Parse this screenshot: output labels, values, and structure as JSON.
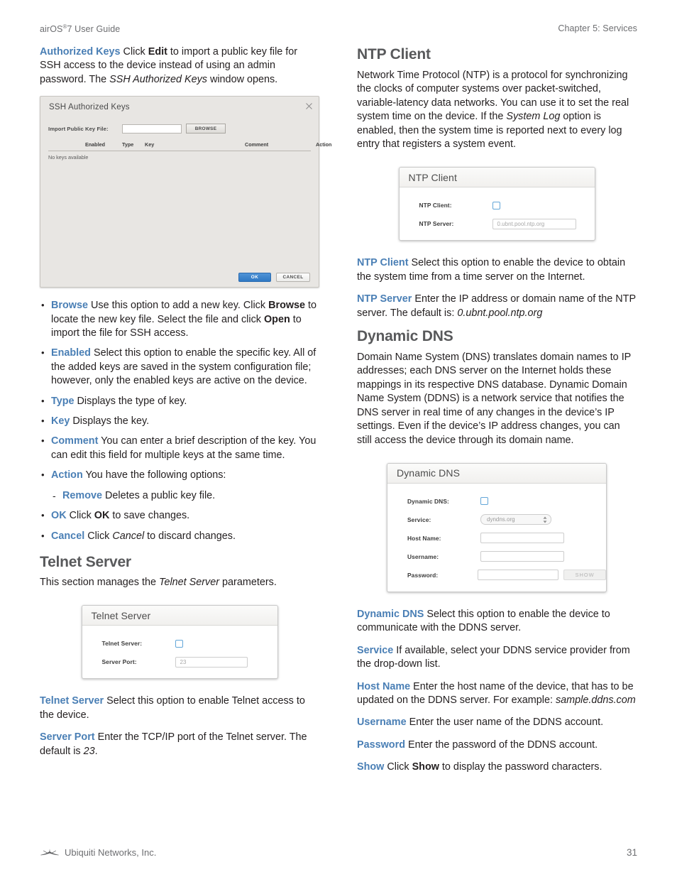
{
  "header": {
    "left_pre": "airOS",
    "left_reg": "®",
    "left_post": "7 User Guide",
    "right": "Chapter 5: Services"
  },
  "left_column": {
    "authorized_keys": {
      "lead": "Authorized Keys",
      "text_1": "  Click ",
      "bold_1": "Edit",
      "text_2": " to import a public key file for SSH access to the device instead of using an admin password. The ",
      "italic_1": "SSH Authorized Keys",
      "text_3": " window opens."
    },
    "ssh_dialog": {
      "title": "SSH Authorized Keys",
      "close_icon": "close-icon",
      "import_label": "Import Public Key File:",
      "import_value": "",
      "browse_button": "BROWSE",
      "columns": [
        "Enabled",
        "Type",
        "Key",
        "Comment",
        "Action"
      ],
      "empty_message": "No keys available",
      "ok_button": "OK",
      "cancel_button": "CANCEL"
    },
    "bullets": [
      {
        "lead": "Browse",
        "parts": [
          {
            "t": "  Use this option to add a new key. Click "
          },
          {
            "t": "Browse",
            "s": "bold"
          },
          {
            "t": " to locate the new key file. Select the file and click "
          },
          {
            "t": "Open",
            "s": "bold"
          },
          {
            "t": " to import the file for SSH access."
          }
        ]
      },
      {
        "lead": "Enabled",
        "parts": [
          {
            "t": "  Select this option to enable the specific key. All of the added keys are saved in the system configuration file; however, only the enabled keys are active on the device."
          }
        ]
      },
      {
        "lead": "Type",
        "parts": [
          {
            "t": "  Displays the type of key."
          }
        ]
      },
      {
        "lead": "Key",
        "parts": [
          {
            "t": "  Displays the key."
          }
        ]
      },
      {
        "lead": "Comment",
        "parts": [
          {
            "t": "  You can enter a brief description of the key. You can edit this field for multiple keys at the same time."
          }
        ]
      },
      {
        "lead": "Action",
        "parts": [
          {
            "t": "  You have the following options:"
          }
        ]
      },
      {
        "sub": true,
        "lead": "Remove",
        "parts": [
          {
            "t": "  Deletes a public key file."
          }
        ]
      },
      {
        "lead": "OK",
        "parts": [
          {
            "t": "  Click "
          },
          {
            "t": "OK",
            "s": "bold"
          },
          {
            "t": " to save changes."
          }
        ]
      },
      {
        "lead": "Cancel",
        "parts": [
          {
            "t": "  Click "
          },
          {
            "t": "Cancel",
            "s": "italic"
          },
          {
            "t": " to discard changes."
          }
        ]
      }
    ],
    "telnet_heading": "Telnet Server",
    "telnet_intro": {
      "text_1": "This section manages the ",
      "italic_1": "Telnet Server",
      "text_2": " parameters."
    },
    "telnet_panel": {
      "title": "Telnet Server",
      "rows": [
        {
          "label": "Telnet Server:",
          "type": "checkbox",
          "checked": false
        },
        {
          "label": "Server Port:",
          "type": "text",
          "value": "23"
        }
      ]
    },
    "telnet_desc": [
      {
        "lead": "Telnet Server",
        "parts": [
          {
            "t": "  Select this option to enable Telnet access to the device."
          }
        ]
      },
      {
        "lead": "Server Port",
        "parts": [
          {
            "t": "  Enter the TCP/IP port of the Telnet server. The default is "
          },
          {
            "t": "23",
            "s": "italic"
          },
          {
            "t": "."
          }
        ]
      }
    ]
  },
  "right_column": {
    "ntp_heading": "NTP Client",
    "ntp_intro": {
      "text_1": "Network Time Protocol (NTP) is a protocol for synchronizing the clocks of computer systems over packet-switched, variable-latency data networks. You can use it to set the real system time on the device. If the ",
      "italic_1": "System Log",
      "text_2": " option is enabled, then the system time is reported next to every log entry that registers a system event."
    },
    "ntp_panel": {
      "title": "NTP Client",
      "rows": [
        {
          "label": "NTP Client:",
          "type": "checkbox",
          "checked": false
        },
        {
          "label": "NTP Server:",
          "type": "text",
          "value": "0.ubnt.pool.ntp.org"
        }
      ]
    },
    "ntp_desc": [
      {
        "lead": "NTP Client",
        "parts": [
          {
            "t": "  Select this option to enable the device to obtain the system time from a time server on the Internet."
          }
        ]
      },
      {
        "lead": "NTP Server",
        "parts": [
          {
            "t": "  Enter the IP address or domain name of the NTP server. The default is: "
          },
          {
            "t": "0.ubnt.pool.ntp.org",
            "s": "italic"
          }
        ]
      }
    ],
    "ddns_heading": "Dynamic DNS",
    "ddns_intro": "Domain Name System (DNS) translates domain names to IP addresses; each DNS server on the Internet holds these mappings in its respective DNS database. Dynamic Domain Name System (DDNS) is a network service that notifies the DNS server in real time of any changes in the device’s IP settings. Even if the device’s IP address changes, you can still access the device through its domain name.",
    "ddns_panel": {
      "title": "Dynamic DNS",
      "rows": [
        {
          "label": "Dynamic DNS:",
          "type": "checkbox",
          "checked": false
        },
        {
          "label": "Service:",
          "type": "select",
          "value": "dyndns.org"
        },
        {
          "label": "Host Name:",
          "type": "text",
          "value": ""
        },
        {
          "label": "Username:",
          "type": "text",
          "value": ""
        },
        {
          "label": "Password:",
          "type": "password",
          "value": "",
          "button": "SHOW"
        }
      ]
    },
    "ddns_desc": [
      {
        "lead": "Dynamic DNS",
        "parts": [
          {
            "t": "  Select this option to enable the device to communicate with the DDNS server."
          }
        ]
      },
      {
        "lead": "Service",
        "parts": [
          {
            "t": "  If available, select your DDNS service provider from the drop-down list."
          }
        ]
      },
      {
        "lead": "Host Name",
        "parts": [
          {
            "t": "  Enter the host name of the device, that has to be updated on the DDNS server. For example: "
          },
          {
            "t": "sample.ddns.com",
            "s": "italic"
          }
        ]
      },
      {
        "lead": "Username",
        "parts": [
          {
            "t": "  Enter the user name of the DDNS account."
          }
        ]
      },
      {
        "lead": "Password",
        "parts": [
          {
            "t": "  Enter the password of the DDNS account."
          }
        ]
      },
      {
        "lead": "Show",
        "parts": [
          {
            "t": "  Click "
          },
          {
            "t": "Show",
            "s": "bold"
          },
          {
            "t": " to display the password characters."
          }
        ]
      }
    ]
  },
  "footer": {
    "logo_icon": "ubiquiti-logo-icon",
    "company": "Ubiquiti Networks, Inc.",
    "page_number": "31"
  },
  "colors": {
    "accent_blue": "#4a7fb5",
    "heading_gray": "#58595b",
    "body_black": "#231f20",
    "header_gray": "#6d6e71",
    "ok_button_blue": "#2f78c4",
    "checkbox_border": "#62a6d8"
  }
}
